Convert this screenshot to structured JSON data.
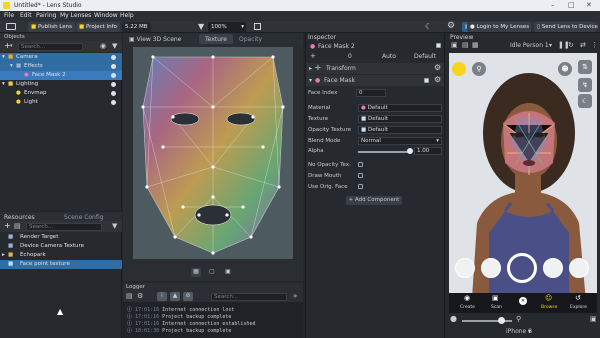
{
  "window": {
    "title": "Untitled* - Lens Studio"
  },
  "menu": [
    "File",
    "Edit",
    "Pairing",
    "My Lenses",
    "Window",
    "Help"
  ],
  "toolbar": {
    "publish": "Publish Lens",
    "project_info": "Project Info",
    "size": "5.22 MB",
    "zoom": "100%",
    "login": "Login to My Lenses",
    "send": "Send Lens to Device"
  },
  "objects": {
    "title": "Objects",
    "search_placeholder": "Search...",
    "items": [
      "Camera",
      "Effects",
      "Face Mask 2",
      "Lighting",
      "Envmap",
      "Light"
    ]
  },
  "resources": {
    "tab1": "Resources",
    "tab2": "Scene Config",
    "search_placeholder": "Search...",
    "items": [
      "Render Target",
      "Device Camera Texture",
      "Echopark",
      "Face point texture"
    ]
  },
  "viewport": {
    "view3d": "View 3D Scene",
    "tab_texture": "Texture",
    "tab_opacity": "Opacity"
  },
  "logger": {
    "title": "Logger",
    "search_placeholder": "Search...",
    "lines": [
      {
        "time": "17:01:16",
        "msg": "Internet connection lost"
      },
      {
        "time": "17:01:16",
        "msg": "Project backup complete"
      },
      {
        "time": "17:01:16",
        "msg": "Internet connection established"
      },
      {
        "time": "18:01:30",
        "msg": "Project backup complete"
      }
    ]
  },
  "inspector": {
    "title": "Inspector",
    "object_name": "Face Mask 2",
    "layer_num": "0",
    "auto": "Auto",
    "default": "Default",
    "transform": "Transform",
    "facemask": "Face Mask",
    "face_index_label": "Face Index",
    "face_index": "0",
    "material_label": "Material",
    "material": "Default",
    "texture_label": "Texture",
    "texture": "Default",
    "opacity_label": "Opacity Texture",
    "opacity": "Default",
    "blend_label": "Blend Mode",
    "blend": "Normal",
    "alpha_label": "Alpha",
    "alpha": "1.00",
    "no_opacity": "No Opacity Tex.",
    "draw_mouth": "Draw Mouth",
    "use_orig": "Use Orig. Face",
    "add_component": "+ Add Component"
  },
  "preview": {
    "title": "Preview",
    "person": "Idle Person 1",
    "device": "iPhone 8",
    "nav": [
      "Create",
      "Scan",
      "",
      "Browse",
      "Explore"
    ]
  }
}
